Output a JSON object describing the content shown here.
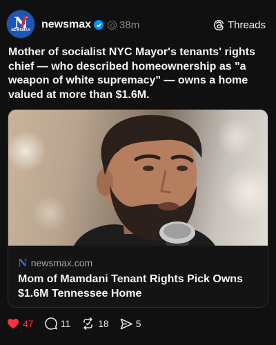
{
  "header": {
    "avatar_label": "NEWSMAX",
    "avatar_letter": "N",
    "handle": "newsmax",
    "time": "38m",
    "threads_label": "Threads"
  },
  "post": {
    "text": "Mother of socialist NYC Mayor's tenants' rights chief — who described  homeownership as \"a weapon of white supremacy\" — owns a home valued at more than $1.6M."
  },
  "link_card": {
    "source_letter": "N",
    "domain": "newsmax.com",
    "headline": "Mom of Mamdani Tenant Rights Pick Owns $1.6M Tennessee Home"
  },
  "actions": {
    "likes": "47",
    "replies": "11",
    "reposts": "18",
    "shares": "5"
  },
  "colors": {
    "background": "#101010",
    "like_red": "#ff3040",
    "verified_blue": "#0095f6",
    "brand_blue": "#1b56b8"
  },
  "icons": [
    "verified-badge-icon",
    "meta-icon",
    "threads-logo-icon",
    "heart-icon",
    "reply-icon",
    "repost-icon",
    "share-icon"
  ]
}
